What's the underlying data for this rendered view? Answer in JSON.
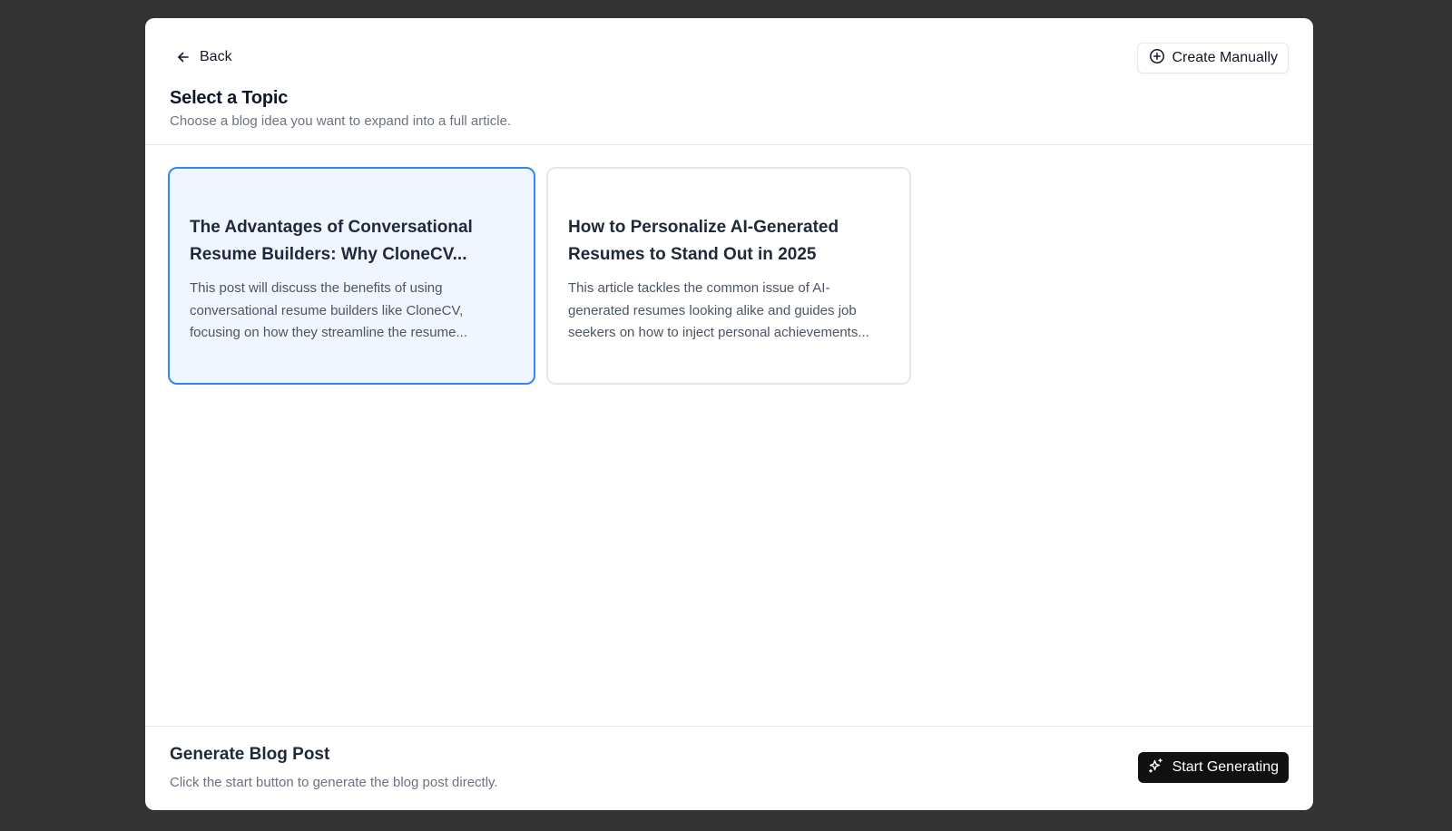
{
  "header": {
    "back_label": "Back",
    "create_manually_label": "Create Manually",
    "title": "Select a Topic",
    "subtitle": "Choose a blog idea you want to expand into a full article."
  },
  "topics": [
    {
      "title": "The Advantages of Conversational Resume Builders: Why CloneCV...",
      "description": "This post will discuss the benefits of using conversational resume builders like CloneCV, focusing on how they streamline the resume...",
      "selected": true
    },
    {
      "title": "How to Personalize AI-Generated Resumes to Stand Out in 2025",
      "description": "This article tackles the common issue of AI-generated resumes looking alike and guides job seekers on how to inject personal achievements...",
      "selected": false
    }
  ],
  "footer": {
    "title": "Generate Blog Post",
    "subtitle": "Click the start button to generate the blog post directly.",
    "start_label": "Start Generating"
  },
  "colors": {
    "backdrop": "#333333",
    "selected_border": "#3b82f6",
    "selected_background": "#eff6ff",
    "primary_button": "#111111"
  },
  "icons": {
    "back": "arrow-left-icon",
    "create": "plus-circle-icon",
    "start": "sparkles-icon"
  }
}
